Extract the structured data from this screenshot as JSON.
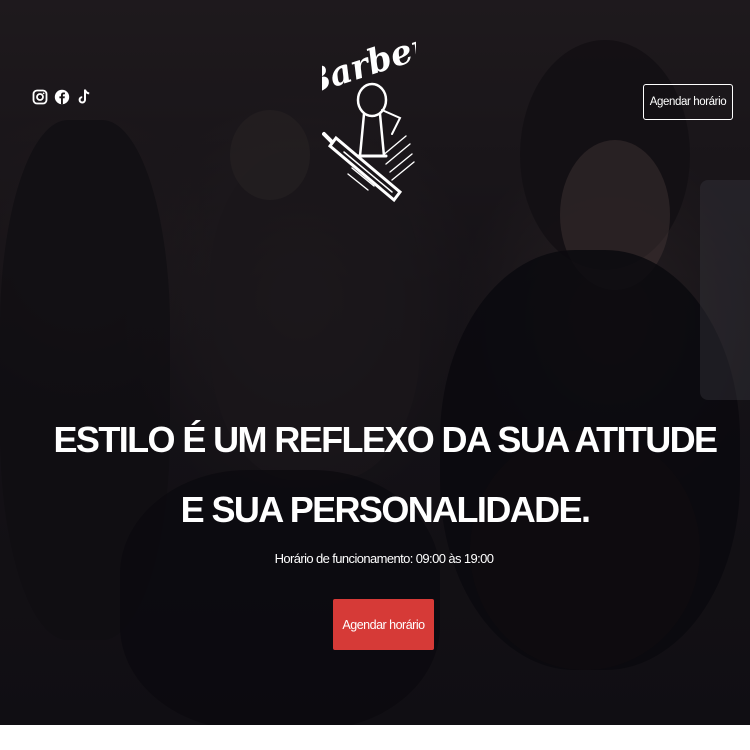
{
  "header": {
    "social_icons": [
      "instagram-icon",
      "facebook-icon",
      "tiktok-icon"
    ],
    "logo_text": "Barber",
    "cta_label": "Agendar horário"
  },
  "hero": {
    "headline_line1": "ESTILO É UM REFLEXO DA SUA ATITUDE",
    "headline_line2": "E SUA PERSONALIDADE.",
    "hours_text": "Horário de funcionamento: 09:00 às 19:00",
    "cta_label": "Agendar horário"
  },
  "colors": {
    "accent": "#d63a37",
    "text": "#ffffff",
    "overlay": "#151213"
  }
}
